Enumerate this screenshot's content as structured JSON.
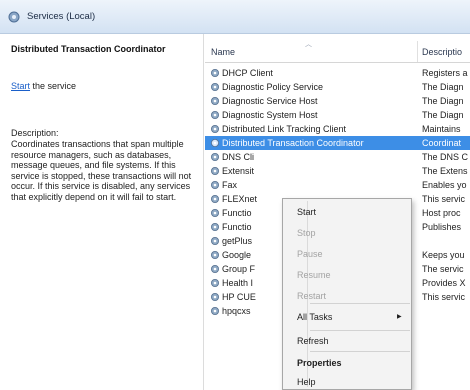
{
  "window": {
    "title": "Services (Local)"
  },
  "left_pane": {
    "heading": "Distributed Transaction Coordinator",
    "start_link": "Start",
    "start_suffix": " the service",
    "description_label": "Description:",
    "description_text": "Coordinates transactions that span multiple resource managers, such as databases, message queues, and file systems. If this service is stopped, these transactions will not occur. If this service is disabled, any services that explicitly depend on it will fail to start."
  },
  "columns": {
    "name": "Name",
    "description": "Descriptio"
  },
  "services": [
    {
      "name": "DHCP Client",
      "description": "Registers a"
    },
    {
      "name": "Diagnostic Policy Service",
      "description": "The Diagn"
    },
    {
      "name": "Diagnostic Service Host",
      "description": "The Diagn"
    },
    {
      "name": "Diagnostic System Host",
      "description": "The Diagn"
    },
    {
      "name": "Distributed Link Tracking Client",
      "description": "Maintains"
    },
    {
      "name": "Distributed Transaction Coordinator",
      "description": "Coordinat",
      "selected": true
    },
    {
      "name": "DNS Cli",
      "description": "The DNS C"
    },
    {
      "name": "Extensit",
      "description": "The Extens"
    },
    {
      "name": "Fax",
      "description": "Enables yo"
    },
    {
      "name": "FLEXnet",
      "description": "This servic"
    },
    {
      "name": "Functio",
      "description": "Host proc"
    },
    {
      "name": "Functio",
      "description": "Publishes"
    },
    {
      "name": "getPlus",
      "description": ""
    },
    {
      "name": "Google",
      "description": "Keeps you"
    },
    {
      "name": "Group F",
      "description": "The servic"
    },
    {
      "name": "Health I",
      "description": "Provides X"
    },
    {
      "name": "HP CUE",
      "description": "This servic"
    },
    {
      "name": "hpqcxs",
      "description": ""
    }
  ],
  "context_menu": {
    "start": "Start",
    "stop": "Stop",
    "pause": "Pause",
    "resume": "Resume",
    "restart": "Restart",
    "all_tasks": "All Tasks",
    "refresh": "Refresh",
    "properties": "Properties",
    "help": "Help"
  },
  "colors": {
    "selection": "#3d8ee6",
    "link": "#1a5fc9",
    "titlebar": "#d3e2f3"
  },
  "icons": {
    "title": "gear-icon",
    "service": "gear-icon",
    "submenu": "submenu-arrow-icon"
  }
}
